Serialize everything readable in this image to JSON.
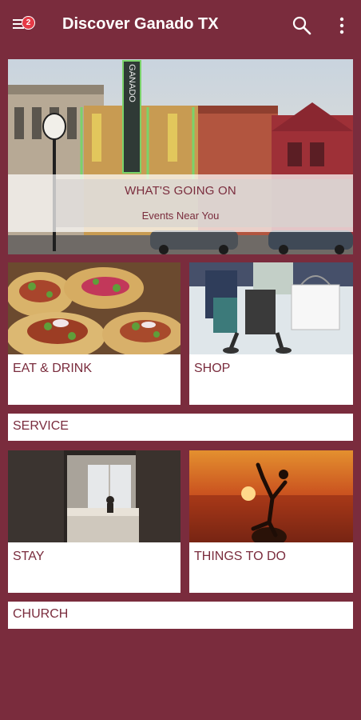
{
  "appbar": {
    "title": "Discover Ganado TX",
    "notification_count": "2"
  },
  "hero": {
    "title": "WHAT'S GOING ON",
    "subtitle": "Events Near You",
    "sign_text": "GANADO"
  },
  "tiles": {
    "eat_drink": "EAT & DRINK",
    "shop": "SHOP",
    "service": "SERVICE",
    "stay": "STAY",
    "things_to_do": "THINGS TO DO",
    "church": "CHURCH"
  },
  "colors": {
    "brand": "#7a2c3d",
    "card": "#ffffff",
    "badge": "#e63946"
  }
}
